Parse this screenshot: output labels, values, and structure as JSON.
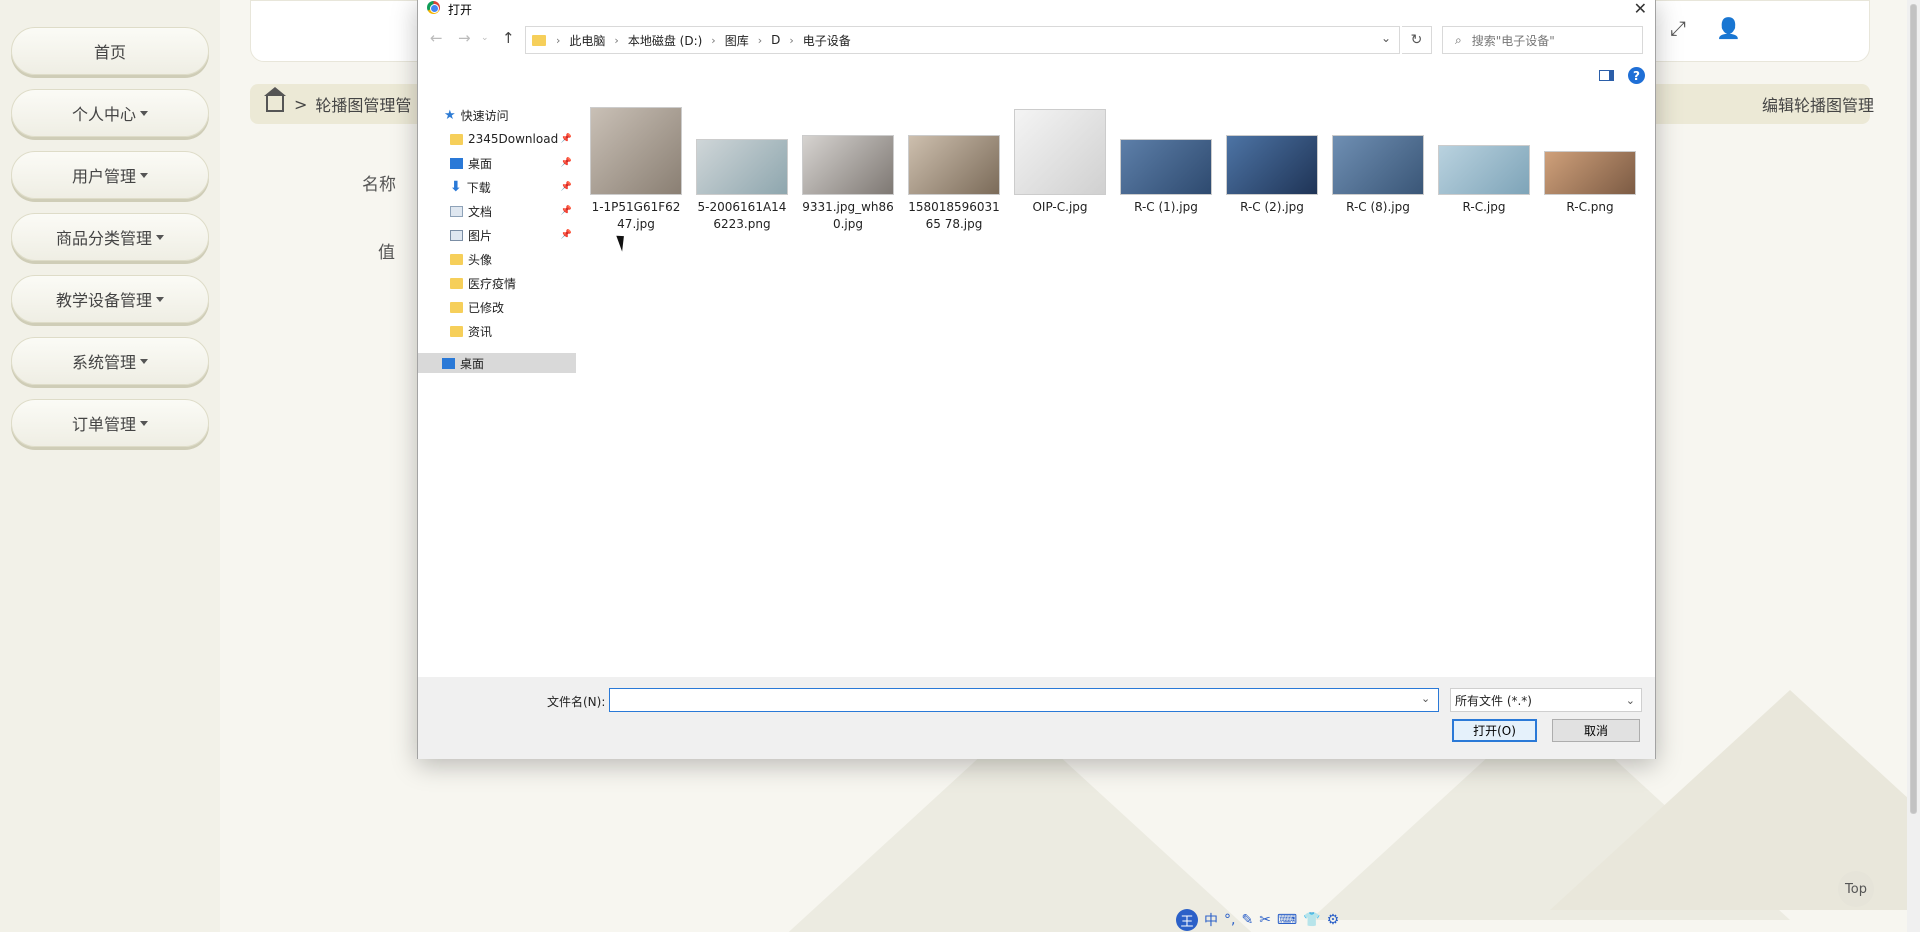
{
  "sidebar": {
    "items": [
      {
        "label": "首页",
        "has_caret": false
      },
      {
        "label": "个人中心",
        "has_caret": true
      },
      {
        "label": "用户管理",
        "has_caret": true
      },
      {
        "label": "商品分类管理",
        "has_caret": true
      },
      {
        "label": "教学设备管理",
        "has_caret": true
      },
      {
        "label": "系统管理",
        "has_caret": true
      },
      {
        "label": "订单管理",
        "has_caret": true
      }
    ]
  },
  "header": {
    "icons": [
      "fullscreen-icon",
      "user-icon"
    ]
  },
  "breadcrumb": {
    "separator": ">",
    "current": "轮播图管理管",
    "page_heading": "编辑轮播图管理"
  },
  "form": {
    "name_label": "名称",
    "value_label": "值"
  },
  "top_button": "Top",
  "dialog": {
    "title": "打开",
    "close": "✕",
    "path": [
      "此电脑",
      "本地磁盘 (D:)",
      "图库",
      "D",
      "电子设备"
    ],
    "search_placeholder": "搜索\"电子设备\"",
    "nav": [
      {
        "label": "快速访问",
        "icon": "star-icon",
        "pinned": false
      },
      {
        "label": "2345Download",
        "icon": "folder-icon",
        "pinned": true
      },
      {
        "label": "桌面",
        "icon": "desktop-icon",
        "pinned": true
      },
      {
        "label": "下载",
        "icon": "download-icon",
        "pinned": true
      },
      {
        "label": "文档",
        "icon": "documents-icon",
        "pinned": true
      },
      {
        "label": "图片",
        "icon": "pictures-icon",
        "pinned": true
      },
      {
        "label": "头像",
        "icon": "folder-icon",
        "pinned": false
      },
      {
        "label": "医疗疫情",
        "icon": "folder-icon",
        "pinned": false
      },
      {
        "label": "已修改",
        "icon": "folder-icon",
        "pinned": false
      },
      {
        "label": "资讯",
        "icon": "folder-icon",
        "pinned": false
      },
      {
        "label": "桌面",
        "icon": "desktop-icon",
        "pinned": false,
        "selected": true
      }
    ],
    "files": [
      {
        "name": "1-1P51G61F6247.jpg",
        "colors": [
          "#c9c0b6",
          "#8a7f73"
        ]
      },
      {
        "name": "5-2006161A146223.png",
        "colors": [
          "#cfd6d8",
          "#8ea6ae"
        ]
      },
      {
        "name": "9331.jpg_wh860.jpg",
        "colors": [
          "#d6d3d0",
          "#7e7873"
        ]
      },
      {
        "name": "15801859603165 78.jpg",
        "colors": [
          "#cdbfae",
          "#7b6b59"
        ]
      },
      {
        "name": "OIP-C.jpg",
        "colors": [
          "#f4f4f4",
          "#d0d0d0"
        ]
      },
      {
        "name": "R-C (1).jpg",
        "colors": [
          "#5d7fa9",
          "#2e4a6f"
        ]
      },
      {
        "name": "R-C (2).jpg",
        "colors": [
          "#4d74a5",
          "#1f3456"
        ]
      },
      {
        "name": "R-C (8).jpg",
        "colors": [
          "#6f8fb3",
          "#3a5677"
        ]
      },
      {
        "name": "R-C.jpg",
        "colors": [
          "#b9d2df",
          "#7ea4b8"
        ]
      },
      {
        "name": "R-C.png",
        "colors": [
          "#cfa07a",
          "#7c5b44"
        ]
      }
    ],
    "filename_label": "文件名(N):",
    "filename_value": "",
    "filetype": "所有文件 (*.*)",
    "open_label": "打开(O)",
    "cancel_label": "取消"
  },
  "ime": {
    "logo": "王",
    "items": [
      "中",
      "°,",
      "✎",
      "✂",
      "⌨",
      "👕",
      "⚙"
    ]
  }
}
